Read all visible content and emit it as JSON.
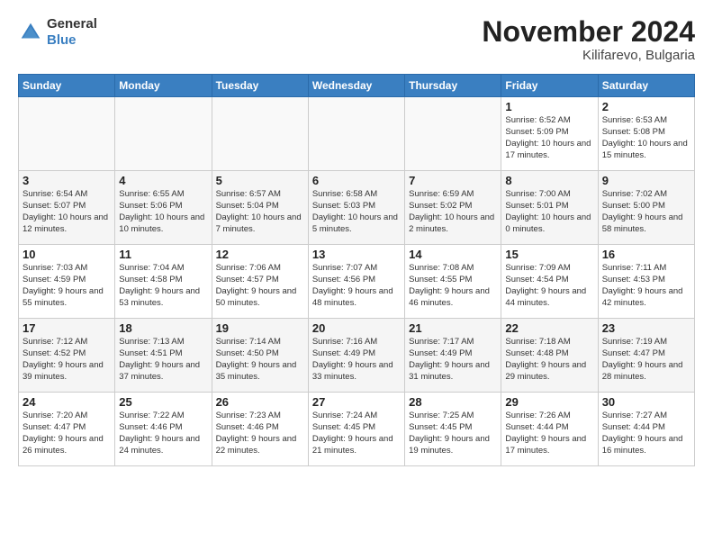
{
  "header": {
    "logo_general": "General",
    "logo_blue": "Blue",
    "month_title": "November 2024",
    "location": "Kilifarevo, Bulgaria"
  },
  "days_of_week": [
    "Sunday",
    "Monday",
    "Tuesday",
    "Wednesday",
    "Thursday",
    "Friday",
    "Saturday"
  ],
  "weeks": [
    [
      {
        "day": "",
        "text": ""
      },
      {
        "day": "",
        "text": ""
      },
      {
        "day": "",
        "text": ""
      },
      {
        "day": "",
        "text": ""
      },
      {
        "day": "",
        "text": ""
      },
      {
        "day": "1",
        "text": "Sunrise: 6:52 AM\nSunset: 5:09 PM\nDaylight: 10 hours and 17 minutes."
      },
      {
        "day": "2",
        "text": "Sunrise: 6:53 AM\nSunset: 5:08 PM\nDaylight: 10 hours and 15 minutes."
      }
    ],
    [
      {
        "day": "3",
        "text": "Sunrise: 6:54 AM\nSunset: 5:07 PM\nDaylight: 10 hours and 12 minutes."
      },
      {
        "day": "4",
        "text": "Sunrise: 6:55 AM\nSunset: 5:06 PM\nDaylight: 10 hours and 10 minutes."
      },
      {
        "day": "5",
        "text": "Sunrise: 6:57 AM\nSunset: 5:04 PM\nDaylight: 10 hours and 7 minutes."
      },
      {
        "day": "6",
        "text": "Sunrise: 6:58 AM\nSunset: 5:03 PM\nDaylight: 10 hours and 5 minutes."
      },
      {
        "day": "7",
        "text": "Sunrise: 6:59 AM\nSunset: 5:02 PM\nDaylight: 10 hours and 2 minutes."
      },
      {
        "day": "8",
        "text": "Sunrise: 7:00 AM\nSunset: 5:01 PM\nDaylight: 10 hours and 0 minutes."
      },
      {
        "day": "9",
        "text": "Sunrise: 7:02 AM\nSunset: 5:00 PM\nDaylight: 9 hours and 58 minutes."
      }
    ],
    [
      {
        "day": "10",
        "text": "Sunrise: 7:03 AM\nSunset: 4:59 PM\nDaylight: 9 hours and 55 minutes."
      },
      {
        "day": "11",
        "text": "Sunrise: 7:04 AM\nSunset: 4:58 PM\nDaylight: 9 hours and 53 minutes."
      },
      {
        "day": "12",
        "text": "Sunrise: 7:06 AM\nSunset: 4:57 PM\nDaylight: 9 hours and 50 minutes."
      },
      {
        "day": "13",
        "text": "Sunrise: 7:07 AM\nSunset: 4:56 PM\nDaylight: 9 hours and 48 minutes."
      },
      {
        "day": "14",
        "text": "Sunrise: 7:08 AM\nSunset: 4:55 PM\nDaylight: 9 hours and 46 minutes."
      },
      {
        "day": "15",
        "text": "Sunrise: 7:09 AM\nSunset: 4:54 PM\nDaylight: 9 hours and 44 minutes."
      },
      {
        "day": "16",
        "text": "Sunrise: 7:11 AM\nSunset: 4:53 PM\nDaylight: 9 hours and 42 minutes."
      }
    ],
    [
      {
        "day": "17",
        "text": "Sunrise: 7:12 AM\nSunset: 4:52 PM\nDaylight: 9 hours and 39 minutes."
      },
      {
        "day": "18",
        "text": "Sunrise: 7:13 AM\nSunset: 4:51 PM\nDaylight: 9 hours and 37 minutes."
      },
      {
        "day": "19",
        "text": "Sunrise: 7:14 AM\nSunset: 4:50 PM\nDaylight: 9 hours and 35 minutes."
      },
      {
        "day": "20",
        "text": "Sunrise: 7:16 AM\nSunset: 4:49 PM\nDaylight: 9 hours and 33 minutes."
      },
      {
        "day": "21",
        "text": "Sunrise: 7:17 AM\nSunset: 4:49 PM\nDaylight: 9 hours and 31 minutes."
      },
      {
        "day": "22",
        "text": "Sunrise: 7:18 AM\nSunset: 4:48 PM\nDaylight: 9 hours and 29 minutes."
      },
      {
        "day": "23",
        "text": "Sunrise: 7:19 AM\nSunset: 4:47 PM\nDaylight: 9 hours and 28 minutes."
      }
    ],
    [
      {
        "day": "24",
        "text": "Sunrise: 7:20 AM\nSunset: 4:47 PM\nDaylight: 9 hours and 26 minutes."
      },
      {
        "day": "25",
        "text": "Sunrise: 7:22 AM\nSunset: 4:46 PM\nDaylight: 9 hours and 24 minutes."
      },
      {
        "day": "26",
        "text": "Sunrise: 7:23 AM\nSunset: 4:46 PM\nDaylight: 9 hours and 22 minutes."
      },
      {
        "day": "27",
        "text": "Sunrise: 7:24 AM\nSunset: 4:45 PM\nDaylight: 9 hours and 21 minutes."
      },
      {
        "day": "28",
        "text": "Sunrise: 7:25 AM\nSunset: 4:45 PM\nDaylight: 9 hours and 19 minutes."
      },
      {
        "day": "29",
        "text": "Sunrise: 7:26 AM\nSunset: 4:44 PM\nDaylight: 9 hours and 17 minutes."
      },
      {
        "day": "30",
        "text": "Sunrise: 7:27 AM\nSunset: 4:44 PM\nDaylight: 9 hours and 16 minutes."
      }
    ]
  ]
}
